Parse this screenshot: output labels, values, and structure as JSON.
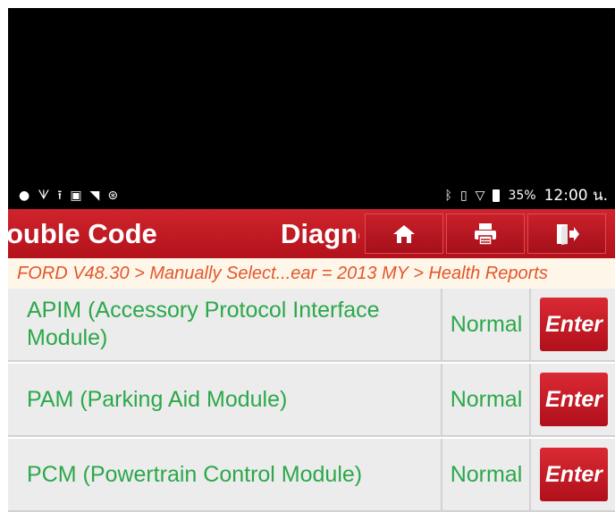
{
  "status_bar": {
    "left_icons": [
      "chat-icon",
      "stethoscope-icon",
      "upload-icon",
      "image-icon",
      "wifi-icon",
      "bluetooth-circle-icon"
    ],
    "right_icons": [
      "bluetooth-icon",
      "vibrate-icon",
      "signal-icon",
      "battery-icon"
    ],
    "battery": "35%",
    "time": "12:00 น."
  },
  "header": {
    "title_left": "ouble Code",
    "title_mid": "Diagnose",
    "buttons": [
      "home",
      "print",
      "exit"
    ],
    "background": "#c41a24"
  },
  "breadcrumb": "FORD V48.30 > Manually Select...ear = 2013 MY > Health Reports",
  "modules": [
    {
      "name": "APIM (Accessory Protocol Interface Module)",
      "status": "Normal",
      "action": "Enter"
    },
    {
      "name": "PAM (Parking Aid Module)",
      "status": "Normal",
      "action": "Enter"
    },
    {
      "name": "PCM (Powertrain Control Module)",
      "status": "Normal",
      "action": "Enter"
    }
  ],
  "colors": {
    "accent_red": "#c41a24",
    "text_green": "#2ba84a",
    "breadcrumb_orange": "#e2572a"
  }
}
